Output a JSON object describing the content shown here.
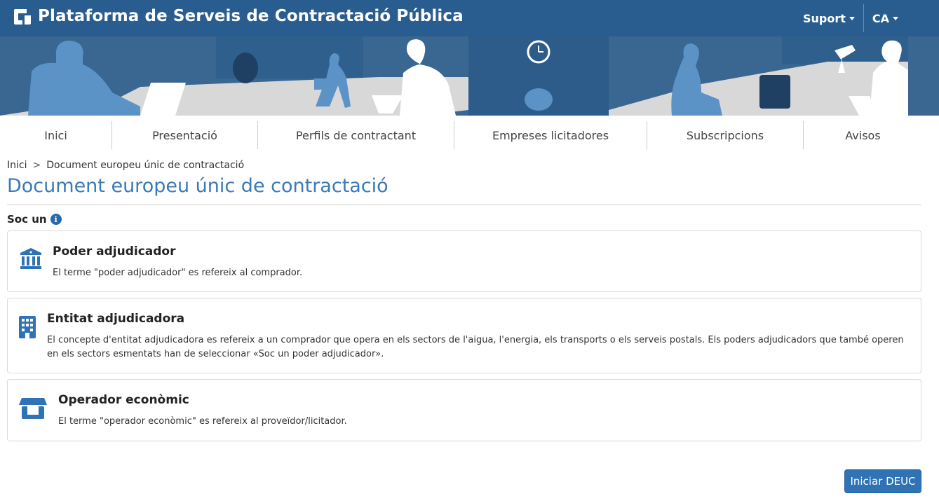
{
  "header": {
    "title": "Plataforma de Serveis de Contractació Pública",
    "support_label": "Suport",
    "language_label": "CA"
  },
  "nav": {
    "items": [
      {
        "label": "Inici"
      },
      {
        "label": "Presentació"
      },
      {
        "label": "Perfils de contractant"
      },
      {
        "label": "Empreses licitadores"
      },
      {
        "label": "Subscripcions"
      },
      {
        "label": "Avisos"
      }
    ]
  },
  "breadcrumb": {
    "home": "Inici",
    "separator": ">",
    "current": "Document europeu únic de contractació"
  },
  "page": {
    "title": "Document europeu únic de contractació",
    "soc_label": "Soc un",
    "info_glyph": "i"
  },
  "options": [
    {
      "title": "Poder adjudicador",
      "description": "El terme \"poder adjudicador\" es refereix al comprador.",
      "icon": "building-columns-icon"
    },
    {
      "title": "Entitat adjudicadora",
      "description": "El concepte d'entitat adjudicadora es refereix a un comprador que opera en els sectors de l'aigua, l'energia, els transports o els serveis postals. Els poders adjudicadors que també operen en els sectors esmentats han de seleccionar «Soc un poder adjudicador».",
      "icon": "office-building-icon"
    },
    {
      "title": "Operador econòmic",
      "description": "El terme \"operador econòmic\" es refereix al proveïdor/licitador.",
      "icon": "store-icon"
    }
  ],
  "actions": {
    "start_label": "Iniciar DEUC"
  },
  "colors": {
    "header_bg": "#2a5d8f",
    "accent": "#3a7ab8",
    "button": "#2f73b5"
  }
}
